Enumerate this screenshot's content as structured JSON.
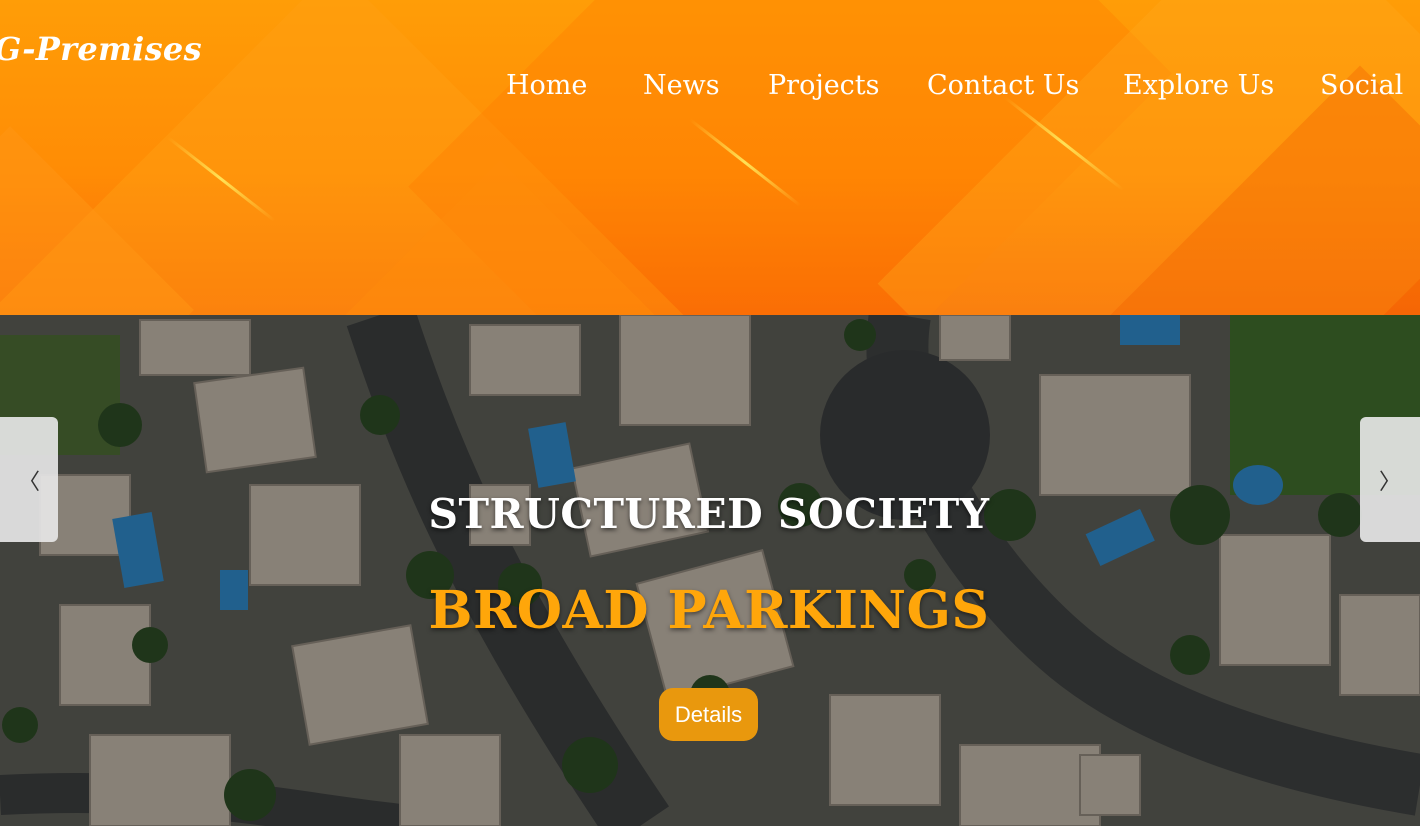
{
  "header": {
    "logo_text": "G-Premises",
    "nav": [
      {
        "label": "Home"
      },
      {
        "label": "News"
      },
      {
        "label": "Projects"
      },
      {
        "label": "Contact Us"
      },
      {
        "label": "Explore Us"
      },
      {
        "label": "Social"
      }
    ]
  },
  "hero": {
    "title": "STRUCTURED SOCIETY",
    "subtitle": "BROAD PARKINGS",
    "button_label": "Details",
    "prev_glyph": "〈",
    "next_glyph": "〉",
    "prev_icon": "chevron-left-icon",
    "next_icon": "chevron-right-icon"
  },
  "colors": {
    "header_orange": "#ff8c05",
    "subtitle_orange": "#ffa60a",
    "button_orange": "#e9980d",
    "text_white": "#ffffff"
  }
}
